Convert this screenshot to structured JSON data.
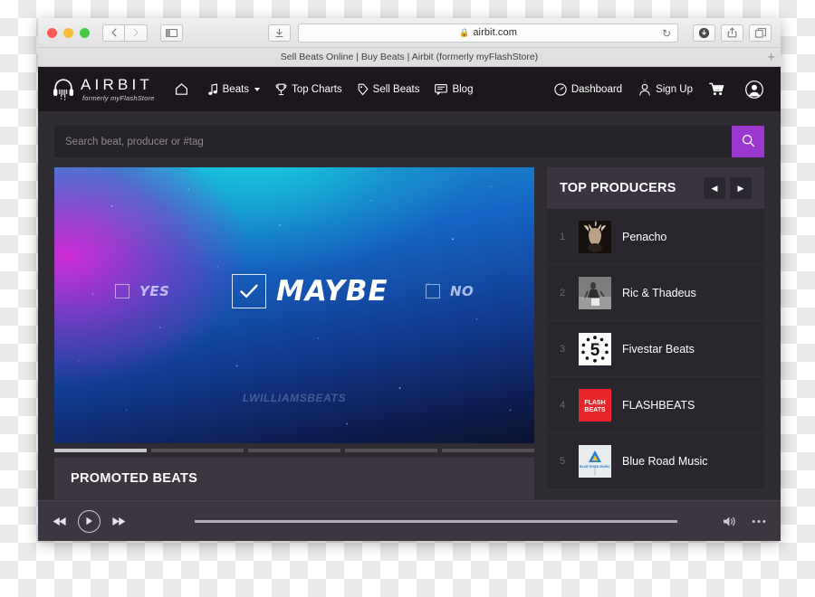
{
  "browser": {
    "url": "airbit.com",
    "lock_icon": "lock-icon",
    "reload_icon": "reload-icon",
    "back_icon": "chevron-left-icon",
    "forward_icon": "chevron-right-icon",
    "sidebar_icon": "sidebar-icon",
    "download_icon": "download-icon",
    "share_icon": "share-icon",
    "tabs_icon": "tabs-icon",
    "tab_title": "Sell Beats Online | Buy Beats | Airbit (formerly myFlashStore)",
    "new_tab_label": "+"
  },
  "site": {
    "logo": {
      "mark": "headphones-icon",
      "name": "AIRBIT",
      "tagline": "formerly myFlashStore"
    },
    "nav_left": [
      {
        "label": "",
        "icon": "home-icon"
      },
      {
        "label": "Beats",
        "icon": "music-note-icon",
        "has_caret": true
      },
      {
        "label": "Top Charts",
        "icon": "trophy-icon"
      },
      {
        "label": "Sell Beats",
        "icon": "tag-icon"
      },
      {
        "label": "Blog",
        "icon": "comment-icon"
      }
    ],
    "nav_right": [
      {
        "label": "Dashboard",
        "icon": "gauge-icon"
      },
      {
        "label": "Sign Up",
        "icon": "user-icon"
      },
      {
        "label": "",
        "icon": "cart-icon"
      },
      {
        "label": "",
        "icon": "avatar-icon"
      }
    ],
    "search": {
      "placeholder": "Search beat, producer or #tag",
      "value": "",
      "button_icon": "search-icon",
      "accent": "#9b38cf"
    },
    "hero": {
      "options": [
        {
          "label": "YES",
          "checked": false
        },
        {
          "label": "MAYBE",
          "checked": true
        },
        {
          "label": "NO",
          "checked": false
        }
      ],
      "check_glyph": "✓",
      "watermark": "LWILLIAMSBEATS",
      "slides": 5,
      "active_slide": 1
    },
    "promoted": {
      "title": "PROMOTED BEATS"
    },
    "top_producers": {
      "title": "TOP PRODUCERS",
      "prev_icon": "arrow-left-icon",
      "next_icon": "arrow-right-icon",
      "prev_glyph": "◀",
      "next_glyph": "▶",
      "items": [
        {
          "rank": "1",
          "name": "Penacho"
        },
        {
          "rank": "2",
          "name": "Ric & Thadeus"
        },
        {
          "rank": "3",
          "name": "Fivestar Beats"
        },
        {
          "rank": "4",
          "name": "FLASHBEATS"
        },
        {
          "rank": "5",
          "name": "Blue Road Music"
        }
      ]
    },
    "player": {
      "prev_icon": "skip-back-icon",
      "play_icon": "play-icon",
      "next_icon": "skip-forward-icon",
      "prev_glyph": "◀◀",
      "play_glyph": "▶",
      "next_glyph": "▶▶",
      "volume_icon": "volume-icon",
      "more_icon": "ellipsis-icon",
      "more_glyph": "•••",
      "progress": 0
    }
  }
}
